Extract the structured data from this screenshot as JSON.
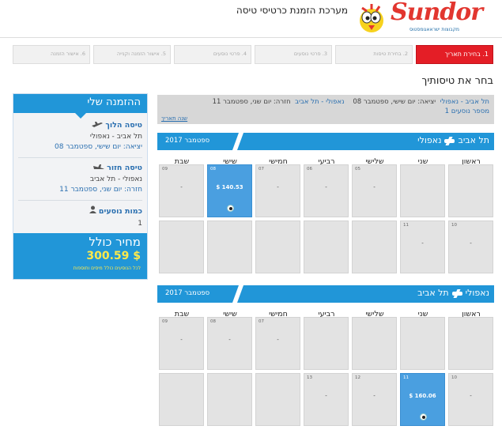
{
  "header": {
    "site_title": "מערכת הזמנת כרטיסי טיסה",
    "logo_text": "Sundor",
    "logo_subtitle": "מקבוצות ישראאגומסטוס"
  },
  "steps": [
    {
      "label": "1. בחירת תאריך",
      "active": true
    },
    {
      "label": "2. בחירת טיסות",
      "active": false
    },
    {
      "label": "3. פרטי נוסעים",
      "active": false
    },
    {
      "label": "4. פרטי נוסעים",
      "active": false
    },
    {
      "label": "5. אישור הזמנה וקנייה",
      "active": false
    },
    {
      "label": "6. אישור הזמנה",
      "active": false
    }
  ],
  "booking_panel": {
    "title": "ההזמנה שלי",
    "outbound": {
      "heading": "טיסה הלוך",
      "route": "תל אביב - נאפולי",
      "detail": "יציאה: יום שישי, ספטמבר 08"
    },
    "return": {
      "heading": "טיסה חזור",
      "route": "נאפולי - תל אביב",
      "detail": "חזרה: יום שני, ספטמבר 11"
    },
    "passengers": {
      "heading": "כמות נוסעים",
      "count": "1"
    },
    "total": {
      "label": "מחיר כולל",
      "price": "$ 300.59",
      "note": "לכל הנוסעים כולל מיסים ותוספות"
    }
  },
  "main": {
    "title": "בחר את טיסותיך",
    "summary": {
      "outbound_route": "תל אביב - נאפולי",
      "outbound_date": "יציאה: יום שישי, ספטמבר 08",
      "return_route": "נאפולי - תל אביב",
      "return_date": "חזרה: יום שני, ספטמבר 11",
      "passengers": "מספר נוסעים 1",
      "change_date": "שנה תאריך"
    },
    "weekdays": [
      "ראשון",
      "שני",
      "שלישי",
      "רביעי",
      "חמישי",
      "שישי",
      "שבת"
    ],
    "calendars": [
      {
        "from": "תל אביב",
        "to": "נאפולי",
        "month": "ספטמבר 2017",
        "rows": [
          [
            {
              "num": "",
              "price": ""
            },
            {
              "num": "",
              "price": ""
            },
            {
              "num": "05",
              "price": "-"
            },
            {
              "num": "06",
              "price": "-"
            },
            {
              "num": "07",
              "price": "-"
            },
            {
              "num": "08",
              "price": "$ 140.53",
              "selected": true
            },
            {
              "num": "09",
              "price": "-"
            }
          ],
          [
            {
              "num": "10",
              "price": "-"
            },
            {
              "num": "11",
              "price": "-"
            },
            {
              "num": "",
              "price": ""
            },
            {
              "num": "",
              "price": ""
            },
            {
              "num": "",
              "price": ""
            },
            {
              "num": "",
              "price": ""
            },
            {
              "num": "",
              "price": ""
            }
          ]
        ]
      },
      {
        "from": "נאפולי",
        "to": "תל אביב",
        "month": "ספטמבר 2017",
        "rows": [
          [
            {
              "num": "",
              "price": ""
            },
            {
              "num": "",
              "price": ""
            },
            {
              "num": "",
              "price": ""
            },
            {
              "num": "",
              "price": ""
            },
            {
              "num": "07",
              "price": "-"
            },
            {
              "num": "08",
              "price": "-"
            },
            {
              "num": "09",
              "price": "-"
            }
          ],
          [
            {
              "num": "10",
              "price": "-"
            },
            {
              "num": "11",
              "price": "$ 160.06",
              "selected": true
            },
            {
              "num": "12",
              "price": "-"
            },
            {
              "num": "13",
              "price": "-"
            },
            {
              "num": "",
              "price": ""
            },
            {
              "num": "",
              "price": ""
            },
            {
              "num": "",
              "price": ""
            }
          ]
        ]
      }
    ]
  },
  "colors": {
    "primary_blue": "#2196d8",
    "active_step_red": "#e41e26",
    "price_yellow": "#ffe94a",
    "cell_gray": "#e3e3e3",
    "selected_cell": "#4a9fe0"
  }
}
